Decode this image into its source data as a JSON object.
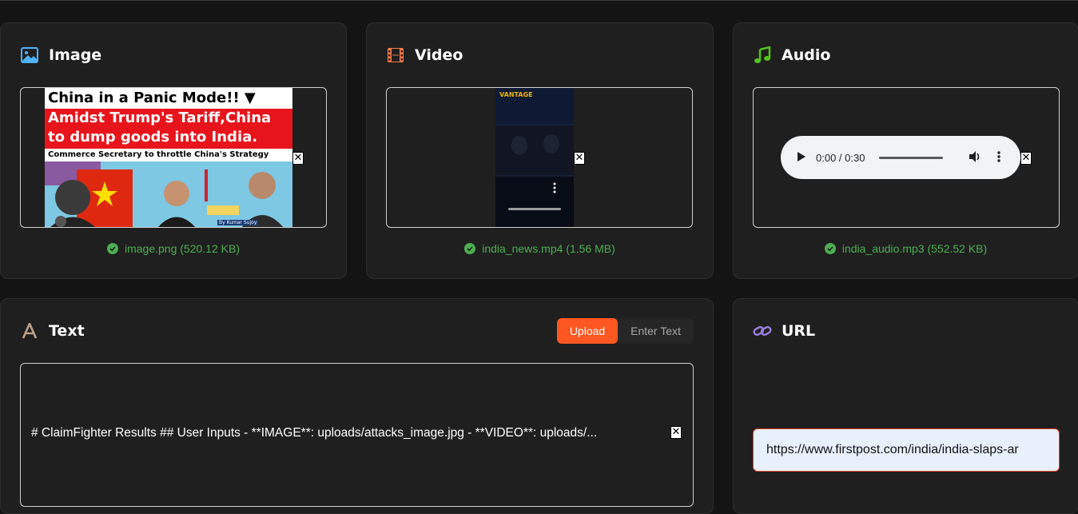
{
  "image_card": {
    "title": "Image",
    "thumbnail": {
      "line1": "China in a Panic Mode!! ▼",
      "line2": "Amidst Trump's Tariff,China",
      "line3": "to dump goods into India.",
      "line4": "Commerce Secretary to throttle China's Strategy",
      "byline": "By Kumar Sujoy"
    },
    "remove_label": "✕",
    "file_status": "image.png (520.12 KB)"
  },
  "video_card": {
    "title": "Video",
    "brand": "VANTAGE",
    "remove_label": "✕",
    "file_status": "india_news.mp4 (1.56 MB)"
  },
  "audio_card": {
    "title": "Audio",
    "player_time": "0:00 / 0:30",
    "remove_label": "✕",
    "file_status": "india_audio.mp3 (552.52 KB)"
  },
  "text_card": {
    "title": "Text",
    "toggle": {
      "upload": "Upload",
      "enter_text": "Enter Text"
    },
    "content": "# ClaimFighter Results ## User Inputs - **IMAGE**: uploads/attacks_image.jpg - **VIDEO**: uploads/...",
    "remove_label": "✕"
  },
  "url_card": {
    "title": "URL",
    "value": "https://www.firstpost.com/india/india-slaps-ar"
  },
  "colors": {
    "accent": "#fe5722",
    "success": "#4caf50",
    "image_icon": "#4fb3ff",
    "video_icon": "#ff7a45",
    "audio_icon": "#52c41a",
    "text_icon": "#bfa28a",
    "url_icon": "#9b7fe0"
  }
}
